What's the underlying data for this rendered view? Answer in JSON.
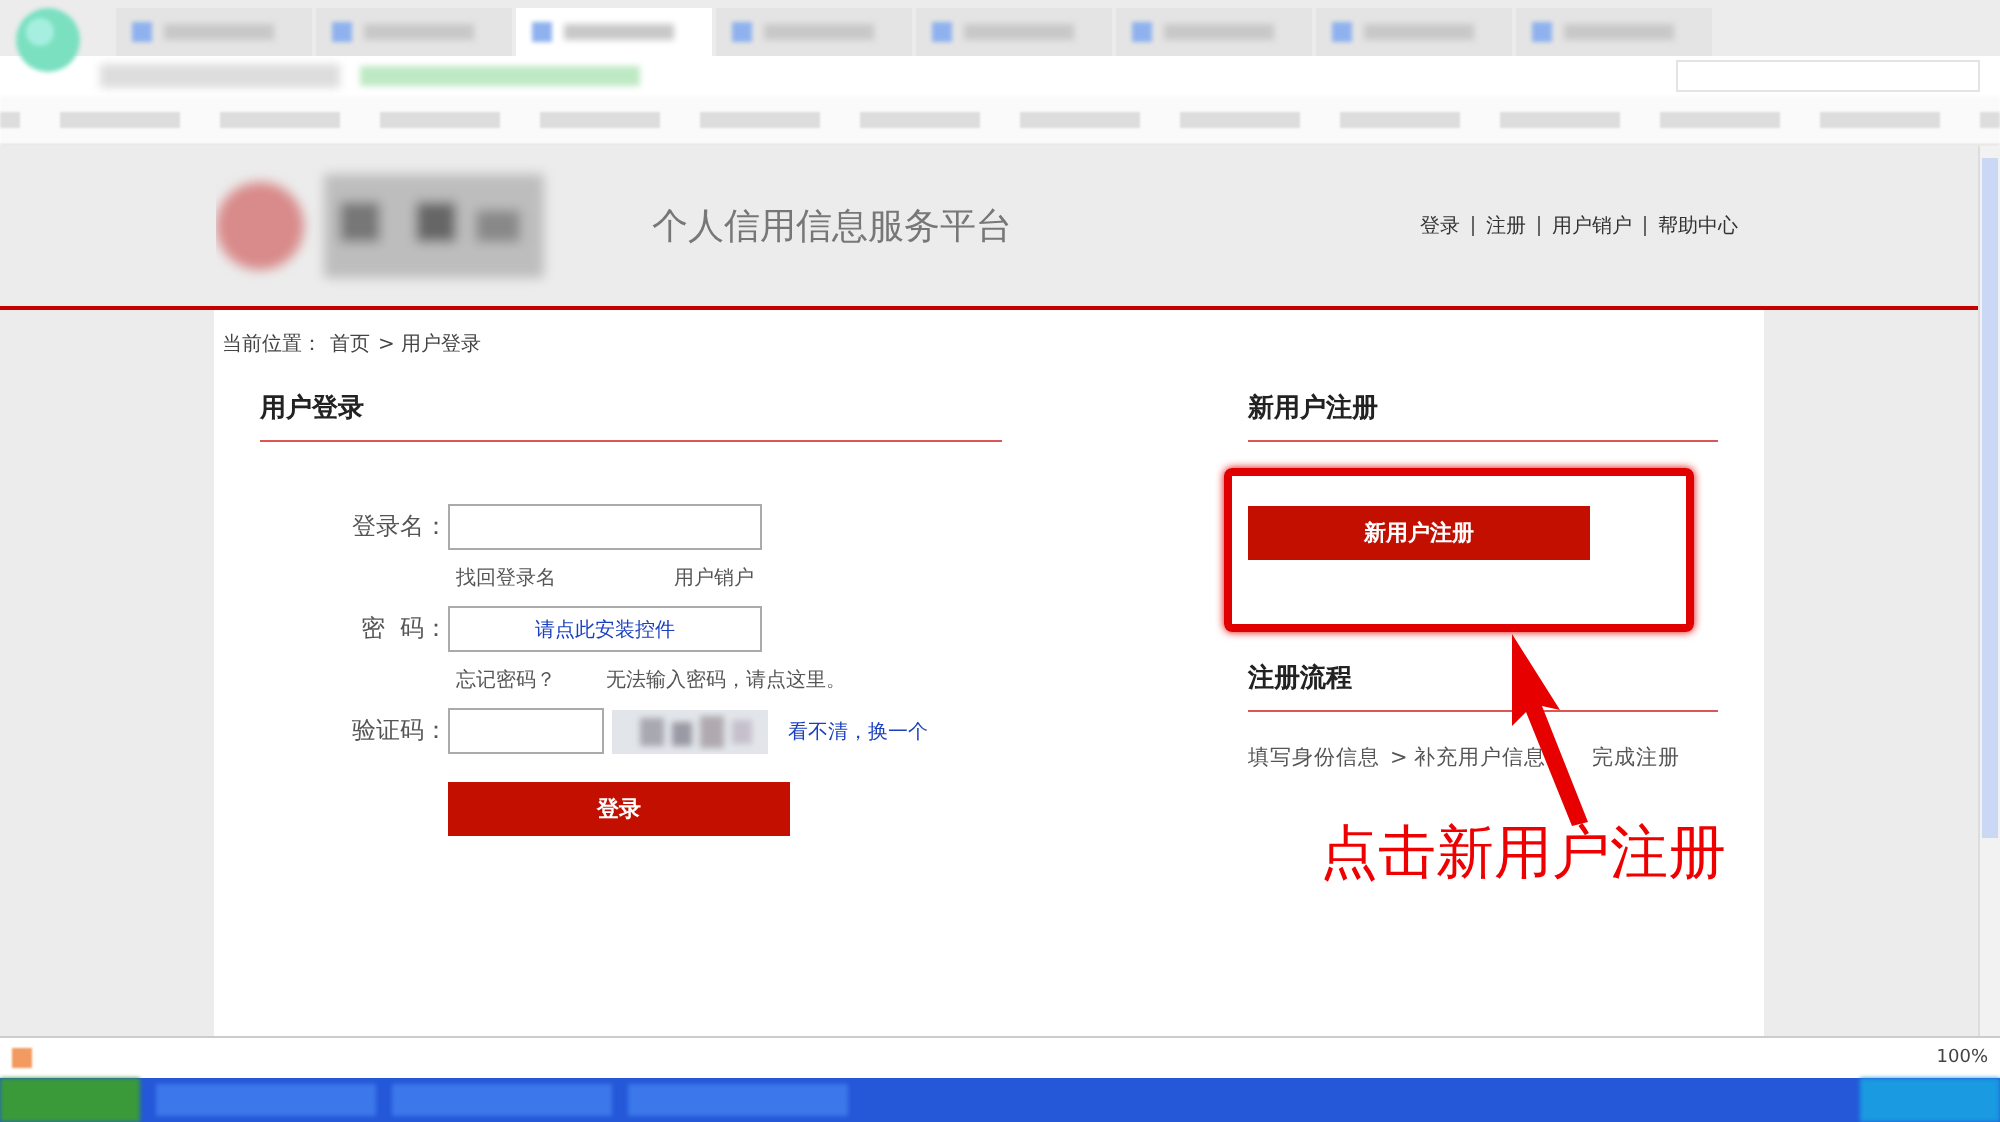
{
  "browser": {
    "tabs": [
      {
        "selected": false
      },
      {
        "selected": false
      },
      {
        "selected": true
      },
      {
        "selected": false
      },
      {
        "selected": false
      },
      {
        "selected": false
      },
      {
        "selected": false
      },
      {
        "selected": false
      }
    ]
  },
  "header": {
    "site_title": "个人信用信息服务平台",
    "links": [
      "登录",
      "注册",
      "用户销户",
      "帮助中心"
    ]
  },
  "breadcrumb": {
    "label": "当前位置：",
    "items": [
      "首页",
      "> 用户登录"
    ]
  },
  "login": {
    "heading": "用户登录",
    "username_label": "登录名：",
    "find_name_link": "找回登录名",
    "cancel_link": "用户销户",
    "password_label": "密  码：",
    "install_control_link": "请点此安装控件",
    "forgot_link": "忘记密码？",
    "cannot_input_link": "无法输入密码，请点这里。",
    "captcha_label": "验证码：",
    "refresh_captcha_link": "看不清，换一个",
    "submit": "登录"
  },
  "register": {
    "heading": "新用户注册",
    "button": "新用户注册",
    "process_heading": "注册流程",
    "steps": [
      "填写身份信息",
      "> 补充用户信息",
      "完成注册"
    ]
  },
  "annotation": {
    "callout": "点击新用户注册"
  },
  "status_bar": {
    "zoom": "100%"
  }
}
